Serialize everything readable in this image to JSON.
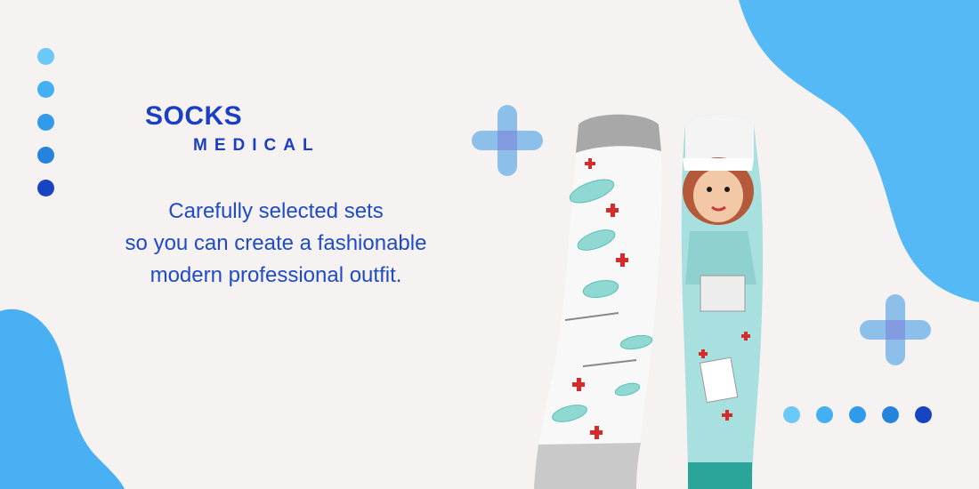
{
  "brand": {
    "line1": "SOCKS",
    "line2": "MEDICAL"
  },
  "tagline": [
    "Carefully selected sets",
    "so you can create a fashionable",
    "modern professional outfit."
  ],
  "colors": {
    "background": "#f6f2f1",
    "brand_blue": "#1a3fc2",
    "text_blue": "#1e4bc7",
    "blob_blue": "#4fb3f5",
    "plus_blue": "#6aaee8",
    "dot_shades": [
      "#6cc8f7",
      "#44b0f2",
      "#2f9bea",
      "#2484dc",
      "#1745c2"
    ]
  },
  "icons": [
    "plus-icon",
    "nurse-sock-illustration",
    "mask-pattern-sock-illustration"
  ]
}
